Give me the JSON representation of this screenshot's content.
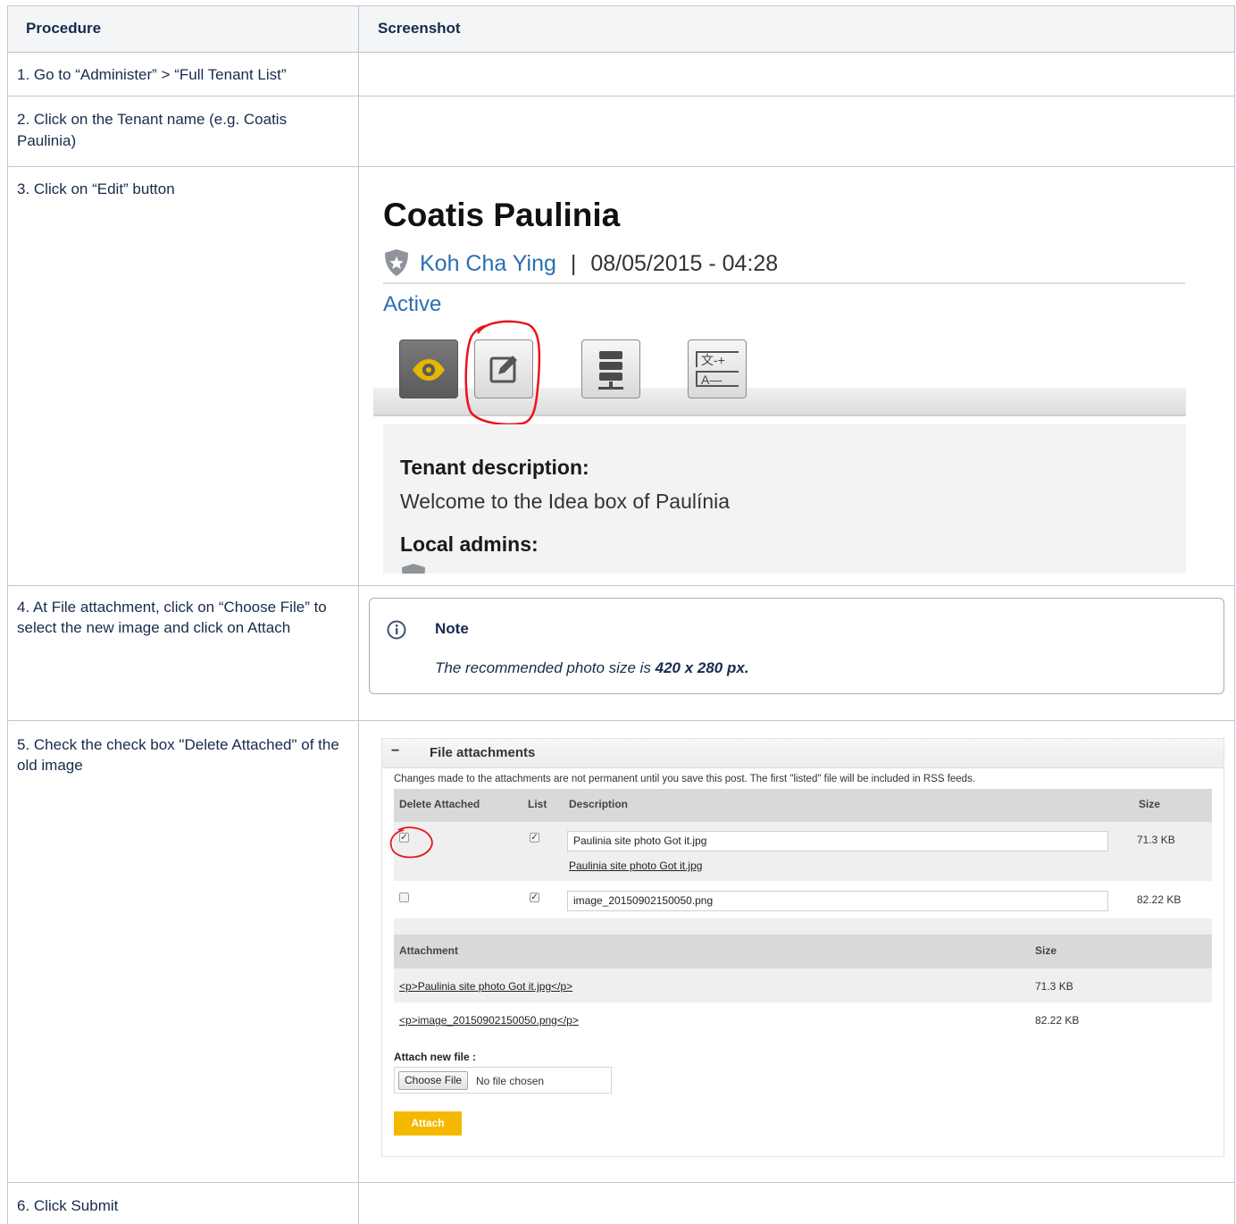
{
  "table": {
    "headers": {
      "procedure": "Procedure",
      "screenshot": "Screenshot"
    },
    "steps": [
      "1. Go to “Administer” > “Full Tenant List”",
      "2. Click on the Tenant name (e.g.  Coatis Paulinia)",
      "3. Click on “Edit” button",
      "4. At File attachment,  click on “Choose File” to select the new image and click on Attach",
      "5. Check the check box \"Delete Attached\" of the old image",
      "6. Click Submit"
    ]
  },
  "tenant_screenshot": {
    "title": "Coatis Paulinia",
    "author": "Koh Cha Ying",
    "separator": "|",
    "datetime": "08/05/2015 - 04:28",
    "status": "Active",
    "tabs": [
      {
        "icon": "eye-icon",
        "active": true
      },
      {
        "icon": "edit-icon",
        "active": false
      },
      {
        "icon": "server-icon",
        "active": false
      },
      {
        "icon": "translate-icon",
        "active": false
      }
    ],
    "tab_glyph_translate_top": "文-+",
    "tab_glyph_translate_bottom": "A—",
    "description_heading": "Tenant description:",
    "description_text": "Welcome to the Idea box of Paulínia",
    "admins_heading": "Local admins:",
    "highlight_color": "#e8141b",
    "eye_color": "#e5b700"
  },
  "note": {
    "title": "Note",
    "text_prefix": "The recommended photo size is ",
    "text_bold": "420 x 280 px."
  },
  "file_attachments": {
    "section_title": "File attachments",
    "toggle": "−",
    "help_text": "Changes made to the attachments are not permanent until you save this post. The first \"listed\" file will be included in RSS feeds.",
    "columns": {
      "delete": "Delete Attached",
      "list": "List",
      "description": "Description",
      "size": "Size"
    },
    "rows": [
      {
        "delete_checked": true,
        "list_checked": true,
        "description": "Paulinia site photo Got it.jpg",
        "link": "Paulinia site photo Got it.jpg",
        "size": "71.3 KB"
      },
      {
        "delete_checked": false,
        "list_checked": true,
        "description": "image_20150902150050.png",
        "link": "",
        "size": "82.22 KB"
      }
    ],
    "attachment_columns": {
      "attachment": "Attachment",
      "size": "Size"
    },
    "attachments": [
      {
        "name": "<p>Paulinia site photo Got it.jpg</p>",
        "size": "71.3 KB"
      },
      {
        "name": "<p>image_20150902150050.png</p>",
        "size": "82.22 KB"
      }
    ],
    "attach_new_label": "Attach new file :",
    "choose_file": "Choose File",
    "no_file": "No file chosen",
    "attach_button": "Attach",
    "accent": "#f5b800"
  }
}
